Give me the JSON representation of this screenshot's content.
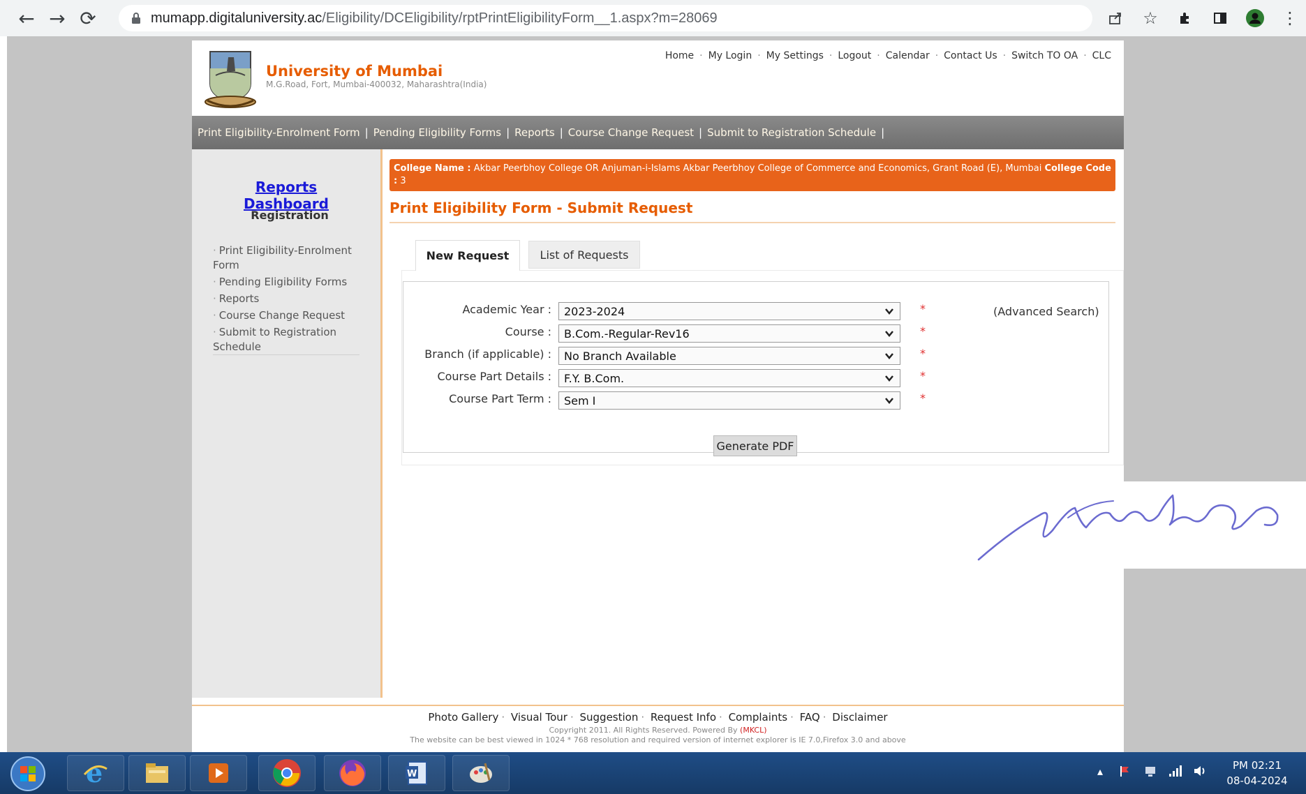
{
  "browser": {
    "url_host": "mumapp.digitaluniversity.ac",
    "url_path": "/Eligibility/DCEligibility/rptPrintEligibilityForm__1.aspx?m=28069"
  },
  "header": {
    "university_name": "University of Mumbai",
    "address": "M.G.Road, Fort, Mumbai-400032, Maharashtra(India)",
    "top_links": [
      "Home",
      "My Login",
      "My Settings",
      "Logout",
      "Calendar",
      "Contact Us",
      "Switch TO OA",
      "CLC"
    ]
  },
  "nav": {
    "items": [
      "Print Eligibility-Enrolment Form",
      "Pending Eligibility Forms",
      "Reports",
      "Course Change Request",
      "Submit to Registration Schedule"
    ]
  },
  "sidebar": {
    "dashboard_title": "Reports Dashboard",
    "section_title": "Registration",
    "items": [
      "Print Eligibility-Enrolment Form",
      "Pending Eligibility Forms",
      "Reports",
      "Course Change Request",
      "Submit to Registration Schedule"
    ]
  },
  "college": {
    "name_label": "College Name :",
    "name_value": "Akbar Peerbhoy College OR Anjuman-i-Islams Akbar Peerbhoy College of Commerce and Economics, Grant Road (E), Mumbai",
    "code_label": "College Code :",
    "code_value": "3"
  },
  "main": {
    "page_title": "Print Eligibility Form - Submit Request",
    "tabs": [
      "New Request",
      "List of Requests"
    ],
    "advanced_search": "(Advanced Search)",
    "required_mark": "*",
    "generate_button": "Generate PDF"
  },
  "form": {
    "fields": [
      {
        "label": "Academic Year :",
        "value": "2023-2024"
      },
      {
        "label": "Course :",
        "value": "B.Com.-Regular-Rev16"
      },
      {
        "label": "Branch (if applicable) :",
        "value": "No Branch Available"
      },
      {
        "label": "Course Part Details :",
        "value": "F.Y. B.Com."
      },
      {
        "label": "Course Part Term :",
        "value": "Sem I"
      }
    ]
  },
  "footer": {
    "links": [
      "Photo Gallery",
      "Visual Tour",
      "Suggestion",
      "Request Info",
      "Complaints",
      "FAQ",
      "Disclaimer"
    ],
    "copyright": "Copyright 2011. All Rights Reserved. Powered By",
    "powered_by": "(MKCL)",
    "note": "The website can be best viewed in 1024 * 768 resolution and required version of internet explorer is IE 7.0,Firefox 3.0 and above"
  },
  "taskbar": {
    "time": "PM 02:21",
    "date": "08-04-2024"
  },
  "colors": {
    "accent_orange": "#e65c00",
    "banner_orange": "#e8631a",
    "nav_gray": "#7a7a7a",
    "dashboard_blue": "#1a1ad8",
    "taskbar_blue": "#1f4d86",
    "signature_ink": "#6b6bd0"
  },
  "icons": {
    "browser": [
      "back-arrow-icon",
      "forward-arrow-icon",
      "reload-icon",
      "lock-icon",
      "share-icon",
      "star-icon",
      "extensions-icon",
      "sidepanel-icon",
      "profile-icon"
    ],
    "taskbar": [
      "windows-start-icon",
      "internet-explorer-icon",
      "file-explorer-icon",
      "media-player-icon",
      "chrome-icon",
      "firefox-icon",
      "word-icon",
      "paint-icon"
    ]
  }
}
